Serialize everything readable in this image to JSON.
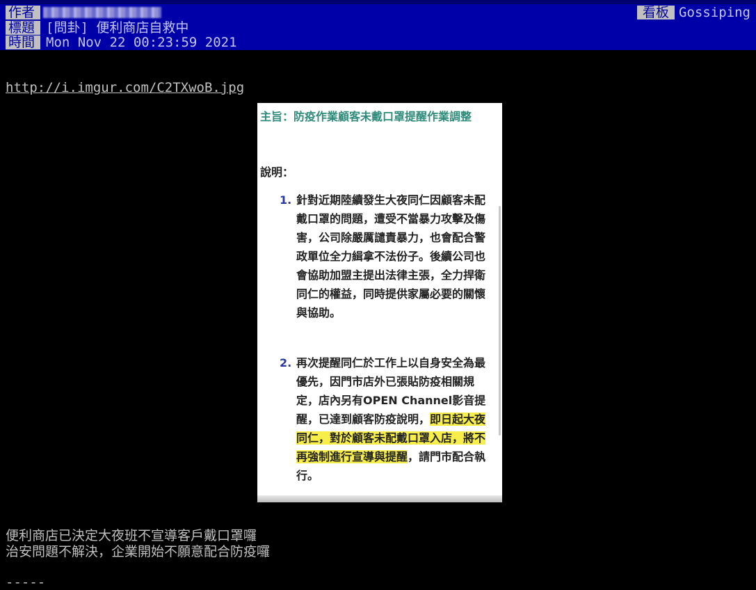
{
  "header": {
    "author_label": "作者",
    "board_label": "看板",
    "board_name": "Gossiping",
    "title_label": "標題",
    "title": "[問卦] 便利商店自救中",
    "time_label": "時間",
    "time": "Mon Nov 22 00:23:59 2021"
  },
  "body": {
    "link": "http://i.imgur.com/C2TXwoB.jpg",
    "line1": "便利商店已決定大夜班不宣導客戶戴口罩囉",
    "line2": "治安問題不解決，企業開始不願意配合防疫囉",
    "separator": "-----"
  },
  "document": {
    "subject_label": "主旨：",
    "subject": "防疫作業顧客未戴口罩提醒作業調整",
    "explain_label": "說明：",
    "item1_num": "1.",
    "item1": "針對近期陸續發生大夜同仁因顧客未配戴口罩的問題，遭受不當暴力攻擊及傷害，公司除嚴厲譴責暴力，也會配合警政單位全力緝拿不法份子。後續公司也會協助加盟主提出法律主張，全力捍衛同仁的權益，同時提供家屬必要的關懷與協助。",
    "item2_num": "2.",
    "item2_pre": "再次提醒同仁於工作上以自身安全為最優先，因門市店外已張貼防疫相關規定，店內另有OPEN Channel影音提醒，已達到顧客防疫說明，",
    "item2_highlight": "即日起大夜同仁，對於顧客未配戴口罩入店，將不再強制進行宣導與提醒",
    "item2_post": "，請門市配合執行。"
  },
  "colors": {
    "header_bg": "#0000a8",
    "label_bg": "#c0c0c0",
    "subject_color": "#2e8b7a",
    "highlight": "#f7ee4a"
  }
}
